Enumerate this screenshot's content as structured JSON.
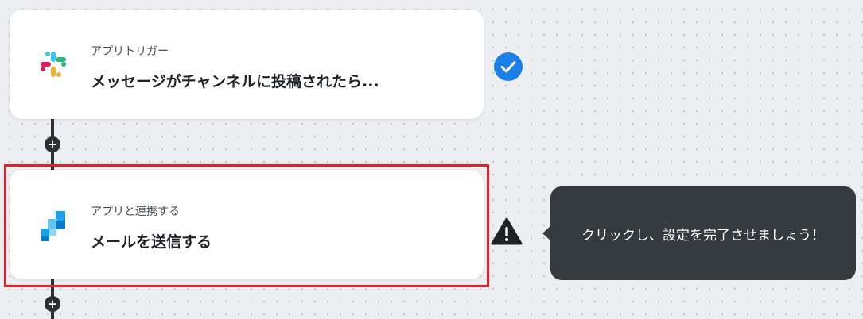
{
  "trigger_card": {
    "subtitle": "アプリトリガー",
    "title": "メッセージがチャンネルに投稿されたら...",
    "icon": "slack-icon",
    "status": "completed"
  },
  "action_card": {
    "subtitle": "アプリと連携する",
    "title": "メールを送信する",
    "icon": "email-app-icon",
    "status": "warning"
  },
  "connector": {
    "add_step_label": "+"
  },
  "tooltip": {
    "text": "クリックし、設定を完了させましょう！"
  },
  "colors": {
    "canvas_bg": "#eceef1",
    "check_blue": "#1a7fe8",
    "selection_red": "#e3202b",
    "tooltip_bg": "#353a41"
  }
}
